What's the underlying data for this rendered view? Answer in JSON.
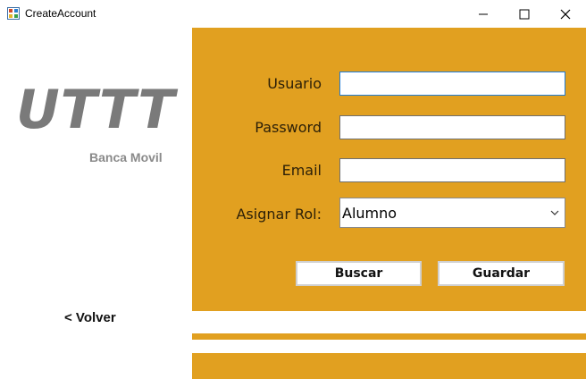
{
  "window": {
    "title": "CreateAccount",
    "minimize_icon": "minimize-icon",
    "maximize_icon": "maximize-icon",
    "close_icon": "close-icon"
  },
  "left": {
    "logo": "UTTT",
    "tagline": "Banca Movil",
    "back_link": "< Volver"
  },
  "form": {
    "usuario_label": "Usuario",
    "usuario_value": "",
    "password_label": "Password",
    "password_value": "",
    "email_label": "Email",
    "email_value": "",
    "rol_label": "Asignar Rol:",
    "rol_selected": "Alumno"
  },
  "buttons": {
    "buscar": "Buscar",
    "guardar": "Guardar"
  },
  "colors": {
    "accent": "#e1a020",
    "logo_gray": "#7a7a7a",
    "focus_border": "#1e7bd6"
  }
}
